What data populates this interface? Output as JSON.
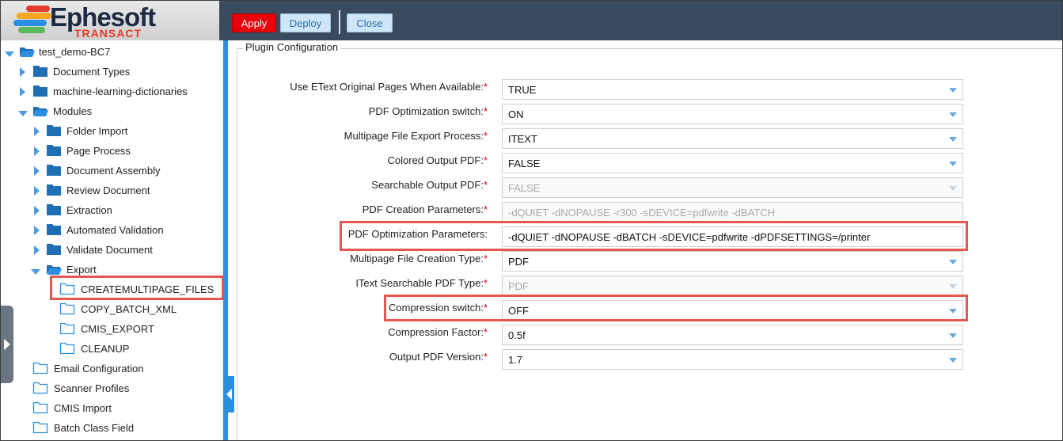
{
  "brand": {
    "name": "Ephesoft",
    "sub": "TRANSACT"
  },
  "toolbar": {
    "apply": "Apply",
    "deploy": "Deploy",
    "close": "Close"
  },
  "tree": {
    "root": "test_demo-BC7",
    "items": [
      "Document Types",
      "machine-learning-dictionaries",
      "Modules",
      "Folder Import",
      "Page Process",
      "Document Assembly",
      "Review Document",
      "Extraction",
      "Automated Validation",
      "Validate Document",
      "Export",
      "CREATEMULTIPAGE_FILES",
      "COPY_BATCH_XML",
      "CMIS_EXPORT",
      "CLEANUP",
      "Email Configuration",
      "Scanner Profiles",
      "CMIS Import",
      "Batch Class Field"
    ]
  },
  "panel": {
    "title": "Plugin Configuration",
    "rows": [
      {
        "label": "Use EText Original Pages When Available:",
        "value": "TRUE"
      },
      {
        "label": "PDF Optimization switch:",
        "value": "ON"
      },
      {
        "label": "Multipage File Export Process:",
        "value": "ITEXT"
      },
      {
        "label": "Colored Output PDF:",
        "value": "FALSE"
      },
      {
        "label": "Searchable Output PDF:",
        "value": "FALSE"
      },
      {
        "label": "PDF Creation Parameters:",
        "value": "-dQUIET -dNOPAUSE -r300 -sDEVICE=pdfwrite -dBATCH"
      },
      {
        "label": "PDF Optimization Parameters:",
        "value": "-dQUIET -dNOPAUSE -dBATCH -sDEVICE=pdfwrite -dPDFSETTINGS=/printer"
      },
      {
        "label": "Multipage File Creation Type:",
        "value": "PDF"
      },
      {
        "label": "IText Searchable PDF Type:",
        "value": "PDF"
      },
      {
        "label": "Compression switch:",
        "value": "OFF"
      },
      {
        "label": "Compression Factor:",
        "value": "0.5f"
      },
      {
        "label": "Output PDF Version:",
        "value": "1.7"
      }
    ]
  },
  "colors": {
    "header": "#3b4b5f",
    "accent": "#2a8fe0",
    "apply": "#e8000b",
    "highlight": "#e5574f",
    "required": "#e00000"
  }
}
